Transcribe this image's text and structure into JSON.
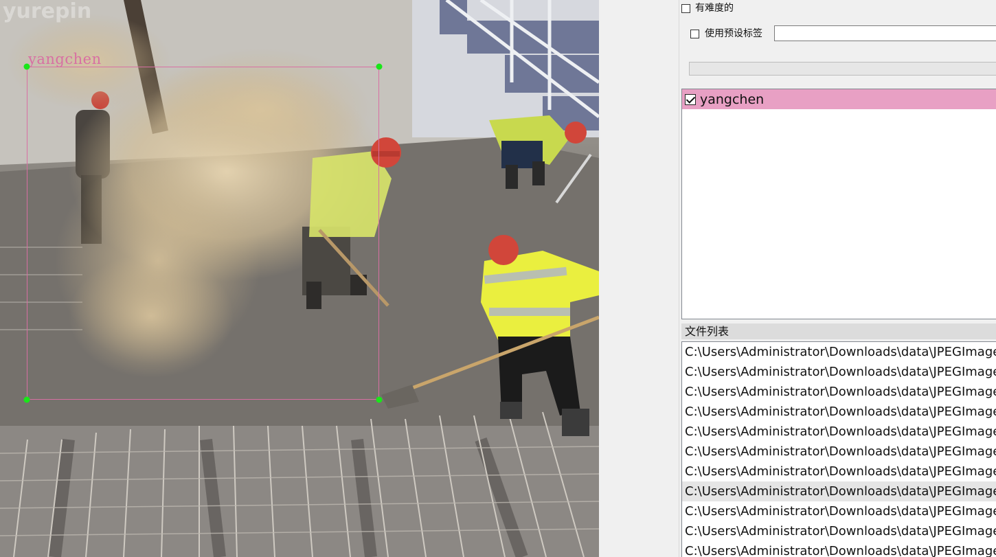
{
  "annotation": {
    "label": "yangchen",
    "box_color": "#d86fa3",
    "handle_color": "#19e619"
  },
  "panel": {
    "difficult_label": "有难度的",
    "use_preset_label": "使用预设标签",
    "preset_value": "",
    "label_list": [
      {
        "label": "yangchen",
        "checked": true,
        "color": "#e8a0c4"
      }
    ],
    "file_list_title": "文件列表",
    "files": [
      "C:\\Users\\Administrator\\Downloads\\data\\JPEGImages",
      "C:\\Users\\Administrator\\Downloads\\data\\JPEGImages",
      "C:\\Users\\Administrator\\Downloads\\data\\JPEGImages",
      "C:\\Users\\Administrator\\Downloads\\data\\JPEGImages",
      "C:\\Users\\Administrator\\Downloads\\data\\JPEGImages",
      "C:\\Users\\Administrator\\Downloads\\data\\JPEGImages",
      "C:\\Users\\Administrator\\Downloads\\data\\JPEGImages",
      "C:\\Users\\Administrator\\Downloads\\data\\JPEGImages",
      "C:\\Users\\Administrator\\Downloads\\data\\JPEGImages",
      "C:\\Users\\Administrator\\Downloads\\data\\JPEGImages",
      "C:\\Users\\Administrator\\Downloads\\data\\JPEGImages"
    ],
    "selected_file_index": 7
  }
}
